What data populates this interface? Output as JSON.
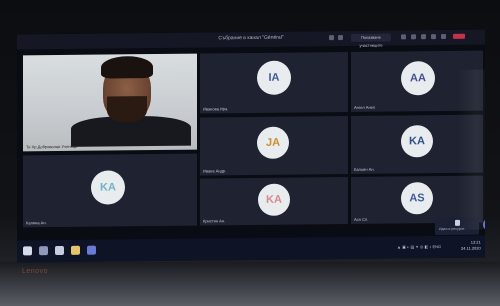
{
  "window": {
    "title": "Събрание в канал \"Général\"",
    "panel_label": "Показване участниците"
  },
  "self_video": {
    "name": "Ти Хр.Доброволци Ученици"
  },
  "participants": [
    {
      "initials": "IA",
      "name": "Иванова Ира"
    },
    {
      "initials": "AA",
      "name": "Ангел Анел"
    },
    {
      "initials": "JA",
      "name": "Ивана Андр."
    },
    {
      "initials": "KA",
      "name": "Калоян Ан."
    },
    {
      "initials": "KA",
      "name": "Калина Ан."
    },
    {
      "initials": "KA",
      "name": "Кристин Ан."
    },
    {
      "initials": "AS",
      "name": "Ася Сп."
    }
  ],
  "taskbar": {
    "start_icon": "windows-start-icon",
    "search_icon": "search-icon",
    "clock_time": "13:21",
    "clock_date": "24.11.2020",
    "notification": "Идеи и ресурси"
  },
  "laptop": {
    "brand": "Lenovo"
  },
  "colors": {
    "avatar_background": "#e9ecef",
    "avatar_IA": "#3b5c99",
    "avatar_AA": "#47508a",
    "avatar_JA": "#c98f2f",
    "avatar_KA1": "#6fb3c4",
    "avatar_KA2": "#d68a8a",
    "avatar_KA3": "#2f4f8a",
    "avatar_AS": "#3b5c99"
  }
}
